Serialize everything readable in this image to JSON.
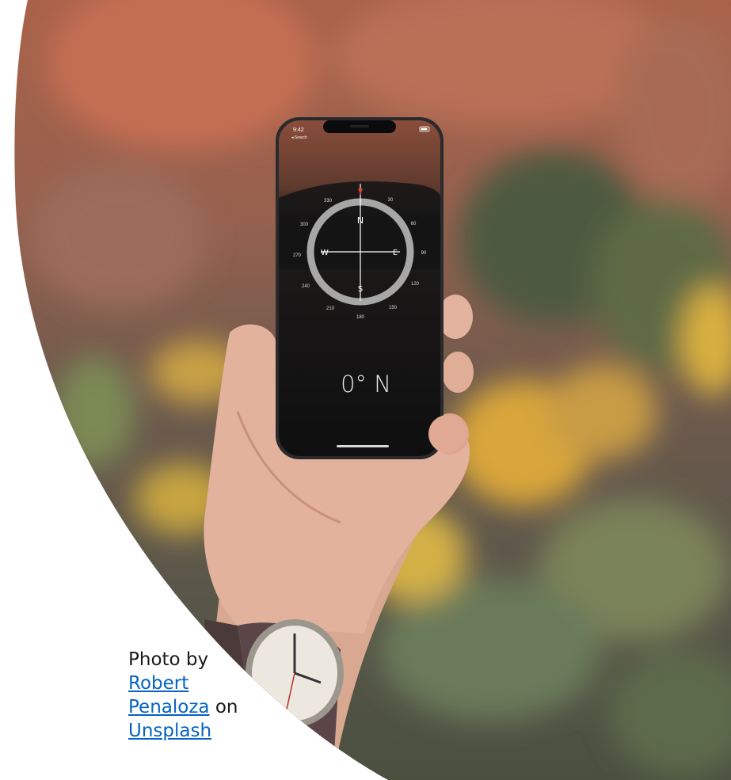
{
  "phone": {
    "status_time": "9:42",
    "status_back": "◂ Search",
    "heading_readout": "0° N"
  },
  "compass": {
    "cardinals": [
      "N",
      "E",
      "S",
      "W"
    ],
    "degree_labels": [
      "30",
      "60",
      "90",
      "120",
      "150",
      "180",
      "210",
      "240",
      "270",
      "300",
      "330"
    ]
  },
  "credit": {
    "prefix": "Photo by",
    "author_first": "Robert",
    "author_last": "Penaloza",
    "on": "on",
    "site": "Unsplash"
  },
  "colors": {
    "link": "#0563c1",
    "page": "#ffffff",
    "text": "#1a1a1a"
  }
}
